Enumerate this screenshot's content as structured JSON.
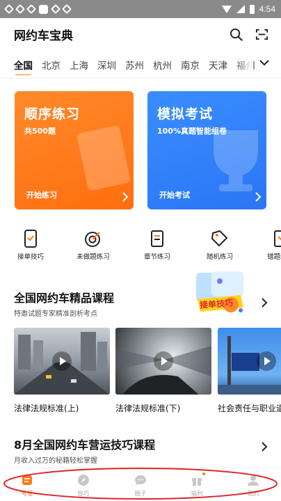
{
  "status_bar": {
    "time": "4:54"
  },
  "header": {
    "title": "网约车宝典",
    "search_icon": "search-icon",
    "scan_icon": "scan-icon"
  },
  "tabs": [
    "全国",
    "北京",
    "上海",
    "深圳",
    "苏州",
    "杭州",
    "南京",
    "天津",
    "福州"
  ],
  "active_tab": "全国",
  "cards": {
    "sequential": {
      "title": "顺序练习",
      "subtitle": "共500题",
      "action": "开始练习",
      "color": "#ff7a1a"
    },
    "mock": {
      "title": "模拟考试",
      "subtitle": "100%真题智能组卷",
      "action": "开始考试",
      "color": "#2f80ff"
    }
  },
  "shortcuts": [
    {
      "label": "接单技巧",
      "icon": "phone-icon"
    },
    {
      "label": "未做题练习",
      "icon": "target-icon"
    },
    {
      "label": "章节练习",
      "icon": "document-icon"
    },
    {
      "label": "随机练习",
      "icon": "tag-icon"
    },
    {
      "label": "错题练习",
      "icon": "error-book-icon"
    }
  ],
  "section_courses": {
    "title": "全国网约车精品课程",
    "subtitle": "特邀试题专家精准剖析考点",
    "badge_text": "接单技巧",
    "videos": [
      {
        "label": "法律法规标准(上)"
      },
      {
        "label": "法律法规标准(下)"
      },
      {
        "label": "社会责任与职业道德"
      }
    ]
  },
  "section_skills": {
    "title": "8月全国网约车营运技巧课程",
    "subtitle": "月收入过万的秘籍轻松掌握"
  },
  "bottom_nav": [
    {
      "label": "考证",
      "icon": "exam-icon",
      "active": true
    },
    {
      "label": "技巧",
      "icon": "compass-icon",
      "active": false
    },
    {
      "label": "圈子",
      "icon": "chat-icon",
      "active": false
    },
    {
      "label": "福利",
      "icon": "gift-icon",
      "active": false
    },
    {
      "label": "我的",
      "icon": "user-icon",
      "active": false
    }
  ],
  "colors": {
    "accent": "#ff7a1a",
    "blue": "#2f80ff",
    "annotation": "#e0242a"
  }
}
